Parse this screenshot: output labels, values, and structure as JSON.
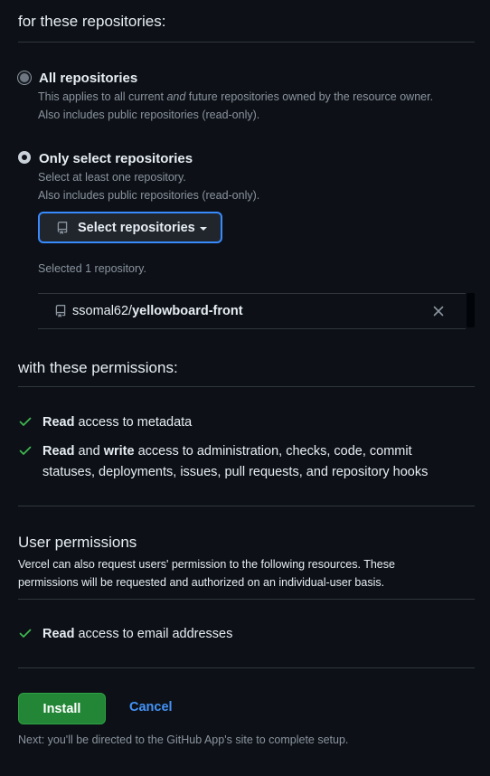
{
  "repos_section": {
    "title": "for these repositories:",
    "all": {
      "label": "All repositories",
      "desc_pre": "This applies to all current ",
      "desc_em": "and",
      "desc_post": " future repositories owned by the resource owner.",
      "desc_line2": "Also includes public repositories (read-only).",
      "selected": false
    },
    "only_select": {
      "label": "Only select repositories",
      "desc_line1": "Select at least one repository.",
      "desc_line2": "Also includes public repositories (read-only).",
      "selected": true
    },
    "select_button": "Select repositories",
    "selected_count": "Selected 1 repository.",
    "selected_repos": [
      {
        "owner": "ssomal62/",
        "name": "yellowboard-front"
      }
    ]
  },
  "permissions_section": {
    "title": "with these permissions:",
    "items": [
      {
        "bold1": "Read",
        "mid": " access to metadata",
        "bold2": "",
        "rest": ""
      },
      {
        "bold1": "Read",
        "mid": " and ",
        "bold2": "write",
        "rest": " access to administration, checks, code, commit statuses, deployments, issues, pull requests, and repository hooks"
      }
    ]
  },
  "user_permissions": {
    "title": "User permissions",
    "description": "Vercel can also request users' permission to the following resources. These permissions will be requested and authorized on an individual-user basis.",
    "items": [
      {
        "bold": "Read",
        "rest": " access to email addresses"
      }
    ]
  },
  "actions": {
    "install": "Install",
    "cancel": "Cancel",
    "next_note": "Next: you'll be directed to the GitHub App's site to complete setup."
  },
  "colors": {
    "background": "#0d1117",
    "border": "#30363d",
    "check": "#3fb950",
    "install": "#238636",
    "link": "#4493f8",
    "focus": "#388bfd"
  }
}
